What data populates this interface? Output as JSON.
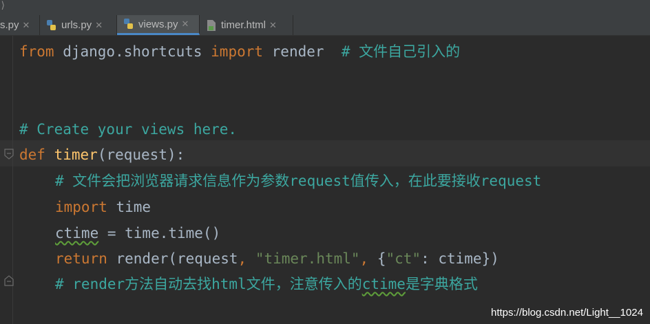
{
  "tabs": [
    {
      "label": "s.py",
      "active": false
    },
    {
      "label": "urls.py",
      "active": false
    },
    {
      "label": "views.py",
      "active": true
    },
    {
      "label": "timer.html",
      "active": false
    }
  ],
  "code": {
    "l1": {
      "kw_from": "from",
      "mod": " django.shortcuts ",
      "kw_import": "import",
      "name": " render  ",
      "comment": "# 文件自己引入的"
    },
    "l4": {
      "comment": "# Create your views here."
    },
    "l5": {
      "kw_def": "def",
      "sp": " ",
      "fn": "timer",
      "args": "(request):"
    },
    "l6": {
      "comment": "# 文件会把浏览器请求信息作为参数request值传入，在此要接收request"
    },
    "l7": {
      "kw_import": "import",
      "name": " time"
    },
    "l8": {
      "var": "ctime",
      "rest": " = time.time()"
    },
    "l9": {
      "kw_return": "return",
      "a": " render(request",
      "comma1": ",",
      "sp": " ",
      "str": "\"timer.html\"",
      "comma2": ",",
      "b": " {",
      "str2": "\"ct\"",
      "c": ": ctime})"
    },
    "l10": {
      "c1": "# render方法自动去找html文件，注意传入的",
      "c2": "ctime",
      "c3": "是字典格式"
    }
  },
  "watermark": "https://blog.csdn.net/Light__1024",
  "colors": {
    "keyword": "#cc7832",
    "comment": "#3ca7a0",
    "string": "#6a8759",
    "function": "#ffc66d",
    "text": "#a9b7c6"
  }
}
